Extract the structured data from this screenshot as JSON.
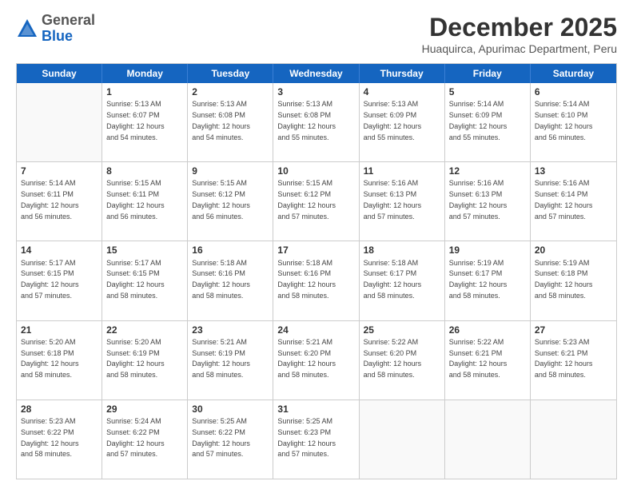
{
  "logo": {
    "general": "General",
    "blue": "Blue"
  },
  "header": {
    "month": "December 2025",
    "location": "Huaquirca, Apurimac Department, Peru"
  },
  "weekdays": [
    "Sunday",
    "Monday",
    "Tuesday",
    "Wednesday",
    "Thursday",
    "Friday",
    "Saturday"
  ],
  "rows": [
    [
      {
        "day": "",
        "text": ""
      },
      {
        "day": "1",
        "text": "Sunrise: 5:13 AM\nSunset: 6:07 PM\nDaylight: 12 hours\nand 54 minutes."
      },
      {
        "day": "2",
        "text": "Sunrise: 5:13 AM\nSunset: 6:08 PM\nDaylight: 12 hours\nand 54 minutes."
      },
      {
        "day": "3",
        "text": "Sunrise: 5:13 AM\nSunset: 6:08 PM\nDaylight: 12 hours\nand 55 minutes."
      },
      {
        "day": "4",
        "text": "Sunrise: 5:13 AM\nSunset: 6:09 PM\nDaylight: 12 hours\nand 55 minutes."
      },
      {
        "day": "5",
        "text": "Sunrise: 5:14 AM\nSunset: 6:09 PM\nDaylight: 12 hours\nand 55 minutes."
      },
      {
        "day": "6",
        "text": "Sunrise: 5:14 AM\nSunset: 6:10 PM\nDaylight: 12 hours\nand 56 minutes."
      }
    ],
    [
      {
        "day": "7",
        "text": "Sunrise: 5:14 AM\nSunset: 6:11 PM\nDaylight: 12 hours\nand 56 minutes."
      },
      {
        "day": "8",
        "text": "Sunrise: 5:15 AM\nSunset: 6:11 PM\nDaylight: 12 hours\nand 56 minutes."
      },
      {
        "day": "9",
        "text": "Sunrise: 5:15 AM\nSunset: 6:12 PM\nDaylight: 12 hours\nand 56 minutes."
      },
      {
        "day": "10",
        "text": "Sunrise: 5:15 AM\nSunset: 6:12 PM\nDaylight: 12 hours\nand 57 minutes."
      },
      {
        "day": "11",
        "text": "Sunrise: 5:16 AM\nSunset: 6:13 PM\nDaylight: 12 hours\nand 57 minutes."
      },
      {
        "day": "12",
        "text": "Sunrise: 5:16 AM\nSunset: 6:13 PM\nDaylight: 12 hours\nand 57 minutes."
      },
      {
        "day": "13",
        "text": "Sunrise: 5:16 AM\nSunset: 6:14 PM\nDaylight: 12 hours\nand 57 minutes."
      }
    ],
    [
      {
        "day": "14",
        "text": "Sunrise: 5:17 AM\nSunset: 6:15 PM\nDaylight: 12 hours\nand 57 minutes."
      },
      {
        "day": "15",
        "text": "Sunrise: 5:17 AM\nSunset: 6:15 PM\nDaylight: 12 hours\nand 58 minutes."
      },
      {
        "day": "16",
        "text": "Sunrise: 5:18 AM\nSunset: 6:16 PM\nDaylight: 12 hours\nand 58 minutes."
      },
      {
        "day": "17",
        "text": "Sunrise: 5:18 AM\nSunset: 6:16 PM\nDaylight: 12 hours\nand 58 minutes."
      },
      {
        "day": "18",
        "text": "Sunrise: 5:18 AM\nSunset: 6:17 PM\nDaylight: 12 hours\nand 58 minutes."
      },
      {
        "day": "19",
        "text": "Sunrise: 5:19 AM\nSunset: 6:17 PM\nDaylight: 12 hours\nand 58 minutes."
      },
      {
        "day": "20",
        "text": "Sunrise: 5:19 AM\nSunset: 6:18 PM\nDaylight: 12 hours\nand 58 minutes."
      }
    ],
    [
      {
        "day": "21",
        "text": "Sunrise: 5:20 AM\nSunset: 6:18 PM\nDaylight: 12 hours\nand 58 minutes."
      },
      {
        "day": "22",
        "text": "Sunrise: 5:20 AM\nSunset: 6:19 PM\nDaylight: 12 hours\nand 58 minutes."
      },
      {
        "day": "23",
        "text": "Sunrise: 5:21 AM\nSunset: 6:19 PM\nDaylight: 12 hours\nand 58 minutes."
      },
      {
        "day": "24",
        "text": "Sunrise: 5:21 AM\nSunset: 6:20 PM\nDaylight: 12 hours\nand 58 minutes."
      },
      {
        "day": "25",
        "text": "Sunrise: 5:22 AM\nSunset: 6:20 PM\nDaylight: 12 hours\nand 58 minutes."
      },
      {
        "day": "26",
        "text": "Sunrise: 5:22 AM\nSunset: 6:21 PM\nDaylight: 12 hours\nand 58 minutes."
      },
      {
        "day": "27",
        "text": "Sunrise: 5:23 AM\nSunset: 6:21 PM\nDaylight: 12 hours\nand 58 minutes."
      }
    ],
    [
      {
        "day": "28",
        "text": "Sunrise: 5:23 AM\nSunset: 6:22 PM\nDaylight: 12 hours\nand 58 minutes."
      },
      {
        "day": "29",
        "text": "Sunrise: 5:24 AM\nSunset: 6:22 PM\nDaylight: 12 hours\nand 57 minutes."
      },
      {
        "day": "30",
        "text": "Sunrise: 5:25 AM\nSunset: 6:22 PM\nDaylight: 12 hours\nand 57 minutes."
      },
      {
        "day": "31",
        "text": "Sunrise: 5:25 AM\nSunset: 6:23 PM\nDaylight: 12 hours\nand 57 minutes."
      },
      {
        "day": "",
        "text": ""
      },
      {
        "day": "",
        "text": ""
      },
      {
        "day": "",
        "text": ""
      }
    ]
  ]
}
